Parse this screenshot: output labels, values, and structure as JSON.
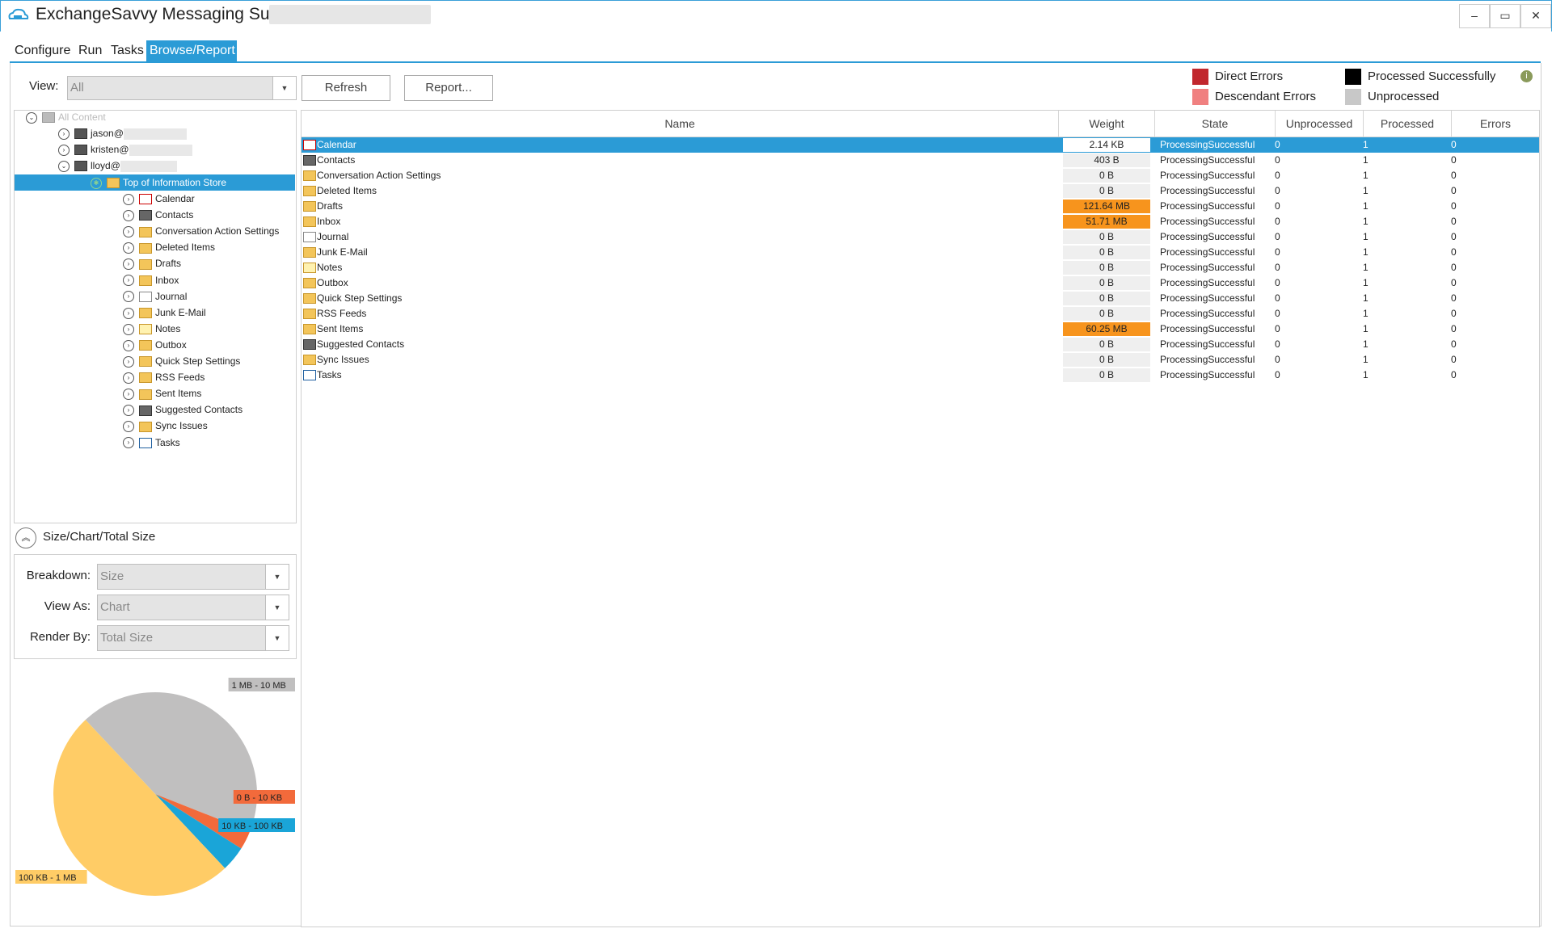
{
  "window": {
    "title": "ExchangeSavvy Messaging Suite -",
    "minimize": "–",
    "restore": "▭",
    "close": "✕"
  },
  "menu": {
    "tabs": [
      {
        "label": "Configure"
      },
      {
        "label": "Run"
      },
      {
        "label": "Tasks"
      },
      {
        "label": "Browse/Report"
      }
    ]
  },
  "toolbar": {
    "view_label": "View:",
    "view_value": "All",
    "refresh": "Refresh",
    "report": "Report..."
  },
  "legend": {
    "direct_errors": "Direct Errors",
    "descendant_errors": "Descendant Errors",
    "processed_successfully": "Processed Successfully",
    "unprocessed": "Unprocessed",
    "colors": {
      "direct_errors": "#c1272d",
      "descendant_errors": "#f08080",
      "processed_successfully": "#000000",
      "unprocessed": "#c8c8c8"
    }
  },
  "tree": {
    "root": "All Content",
    "users": [
      {
        "label": "jason@"
      },
      {
        "label": "kristen@"
      },
      {
        "label": "lloyd@"
      }
    ],
    "store": "Top of Information Store",
    "folders": [
      {
        "label": "Calendar",
        "icon": "calendar-icon"
      },
      {
        "label": "Contacts",
        "icon": "contacts-icon"
      },
      {
        "label": "Conversation Action Settings",
        "icon": "folder-icon"
      },
      {
        "label": "Deleted Items",
        "icon": "folder-icon"
      },
      {
        "label": "Drafts",
        "icon": "folder-icon"
      },
      {
        "label": "Inbox",
        "icon": "folder-icon"
      },
      {
        "label": "Journal",
        "icon": "journal-icon"
      },
      {
        "label": "Junk E-Mail",
        "icon": "folder-icon"
      },
      {
        "label": "Notes",
        "icon": "notes-icon"
      },
      {
        "label": "Outbox",
        "icon": "folder-icon"
      },
      {
        "label": "Quick Step Settings",
        "icon": "folder-icon"
      },
      {
        "label": "RSS Feeds",
        "icon": "folder-icon"
      },
      {
        "label": "Sent Items",
        "icon": "folder-icon"
      },
      {
        "label": "Suggested Contacts",
        "icon": "contacts-icon"
      },
      {
        "label": "Sync Issues",
        "icon": "folder-icon"
      },
      {
        "label": "Tasks",
        "icon": "tasks-icon"
      }
    ]
  },
  "size_panel": {
    "title": "Size/Chart/Total Size",
    "breakdown_label": "Breakdown:",
    "breakdown_value": "Size",
    "viewas_label": "View As:",
    "viewas_value": "Chart",
    "renderby_label": "Render By:",
    "renderby_value": "Total Size"
  },
  "chart_data": {
    "type": "pie",
    "slices": [
      {
        "label": "1 MB - 10 MB",
        "value": 43,
        "color": "#c0bfbf"
      },
      {
        "label": "0 B - 10 KB",
        "value": 3,
        "color": "#f26a3b"
      },
      {
        "label": "10 KB - 100 KB",
        "value": 4,
        "color": "#1aa5d8"
      },
      {
        "label": "100 KB - 1 MB",
        "value": 50,
        "color": "#ffcc66"
      }
    ]
  },
  "grid": {
    "columns": [
      "Name",
      "Weight",
      "State",
      "Unprocessed",
      "Processed",
      "Errors"
    ],
    "rows": [
      {
        "name": "Calendar",
        "icon": "calendar-icon",
        "weight": "2.14 KB",
        "hot": false,
        "state": "ProcessingSuccessful",
        "unprocessed": "0",
        "processed": "1",
        "errors": "0"
      },
      {
        "name": "Contacts",
        "icon": "contacts-icon",
        "weight": "403 B",
        "hot": false,
        "state": "ProcessingSuccessful",
        "unprocessed": "0",
        "processed": "1",
        "errors": "0"
      },
      {
        "name": "Conversation Action Settings",
        "icon": "folder-icon",
        "weight": "0 B",
        "hot": false,
        "state": "ProcessingSuccessful",
        "unprocessed": "0",
        "processed": "1",
        "errors": "0"
      },
      {
        "name": "Deleted Items",
        "icon": "folder-icon",
        "weight": "0 B",
        "hot": false,
        "state": "ProcessingSuccessful",
        "unprocessed": "0",
        "processed": "1",
        "errors": "0"
      },
      {
        "name": "Drafts",
        "icon": "folder-icon",
        "weight": "121.64 MB",
        "hot": true,
        "state": "ProcessingSuccessful",
        "unprocessed": "0",
        "processed": "1",
        "errors": "0"
      },
      {
        "name": "Inbox",
        "icon": "folder-icon",
        "weight": "51.71 MB",
        "hot": true,
        "state": "ProcessingSuccessful",
        "unprocessed": "0",
        "processed": "1",
        "errors": "0"
      },
      {
        "name": "Journal",
        "icon": "journal-icon",
        "weight": "0 B",
        "hot": false,
        "state": "ProcessingSuccessful",
        "unprocessed": "0",
        "processed": "1",
        "errors": "0"
      },
      {
        "name": "Junk E-Mail",
        "icon": "folder-icon",
        "weight": "0 B",
        "hot": false,
        "state": "ProcessingSuccessful",
        "unprocessed": "0",
        "processed": "1",
        "errors": "0"
      },
      {
        "name": "Notes",
        "icon": "notes-icon",
        "weight": "0 B",
        "hot": false,
        "state": "ProcessingSuccessful",
        "unprocessed": "0",
        "processed": "1",
        "errors": "0"
      },
      {
        "name": "Outbox",
        "icon": "folder-icon",
        "weight": "0 B",
        "hot": false,
        "state": "ProcessingSuccessful",
        "unprocessed": "0",
        "processed": "1",
        "errors": "0"
      },
      {
        "name": "Quick Step Settings",
        "icon": "folder-icon",
        "weight": "0 B",
        "hot": false,
        "state": "ProcessingSuccessful",
        "unprocessed": "0",
        "processed": "1",
        "errors": "0"
      },
      {
        "name": "RSS Feeds",
        "icon": "folder-icon",
        "weight": "0 B",
        "hot": false,
        "state": "ProcessingSuccessful",
        "unprocessed": "0",
        "processed": "1",
        "errors": "0"
      },
      {
        "name": "Sent Items",
        "icon": "folder-icon",
        "weight": "60.25 MB",
        "hot": true,
        "state": "ProcessingSuccessful",
        "unprocessed": "0",
        "processed": "1",
        "errors": "0"
      },
      {
        "name": "Suggested Contacts",
        "icon": "contacts-icon",
        "weight": "0 B",
        "hot": false,
        "state": "ProcessingSuccessful",
        "unprocessed": "0",
        "processed": "1",
        "errors": "0"
      },
      {
        "name": "Sync Issues",
        "icon": "folder-icon",
        "weight": "0 B",
        "hot": false,
        "state": "ProcessingSuccessful",
        "unprocessed": "0",
        "processed": "1",
        "errors": "0"
      },
      {
        "name": "Tasks",
        "icon": "tasks-icon",
        "weight": "0 B",
        "hot": false,
        "state": "ProcessingSuccessful",
        "unprocessed": "0",
        "processed": "1",
        "errors": "0"
      }
    ]
  }
}
